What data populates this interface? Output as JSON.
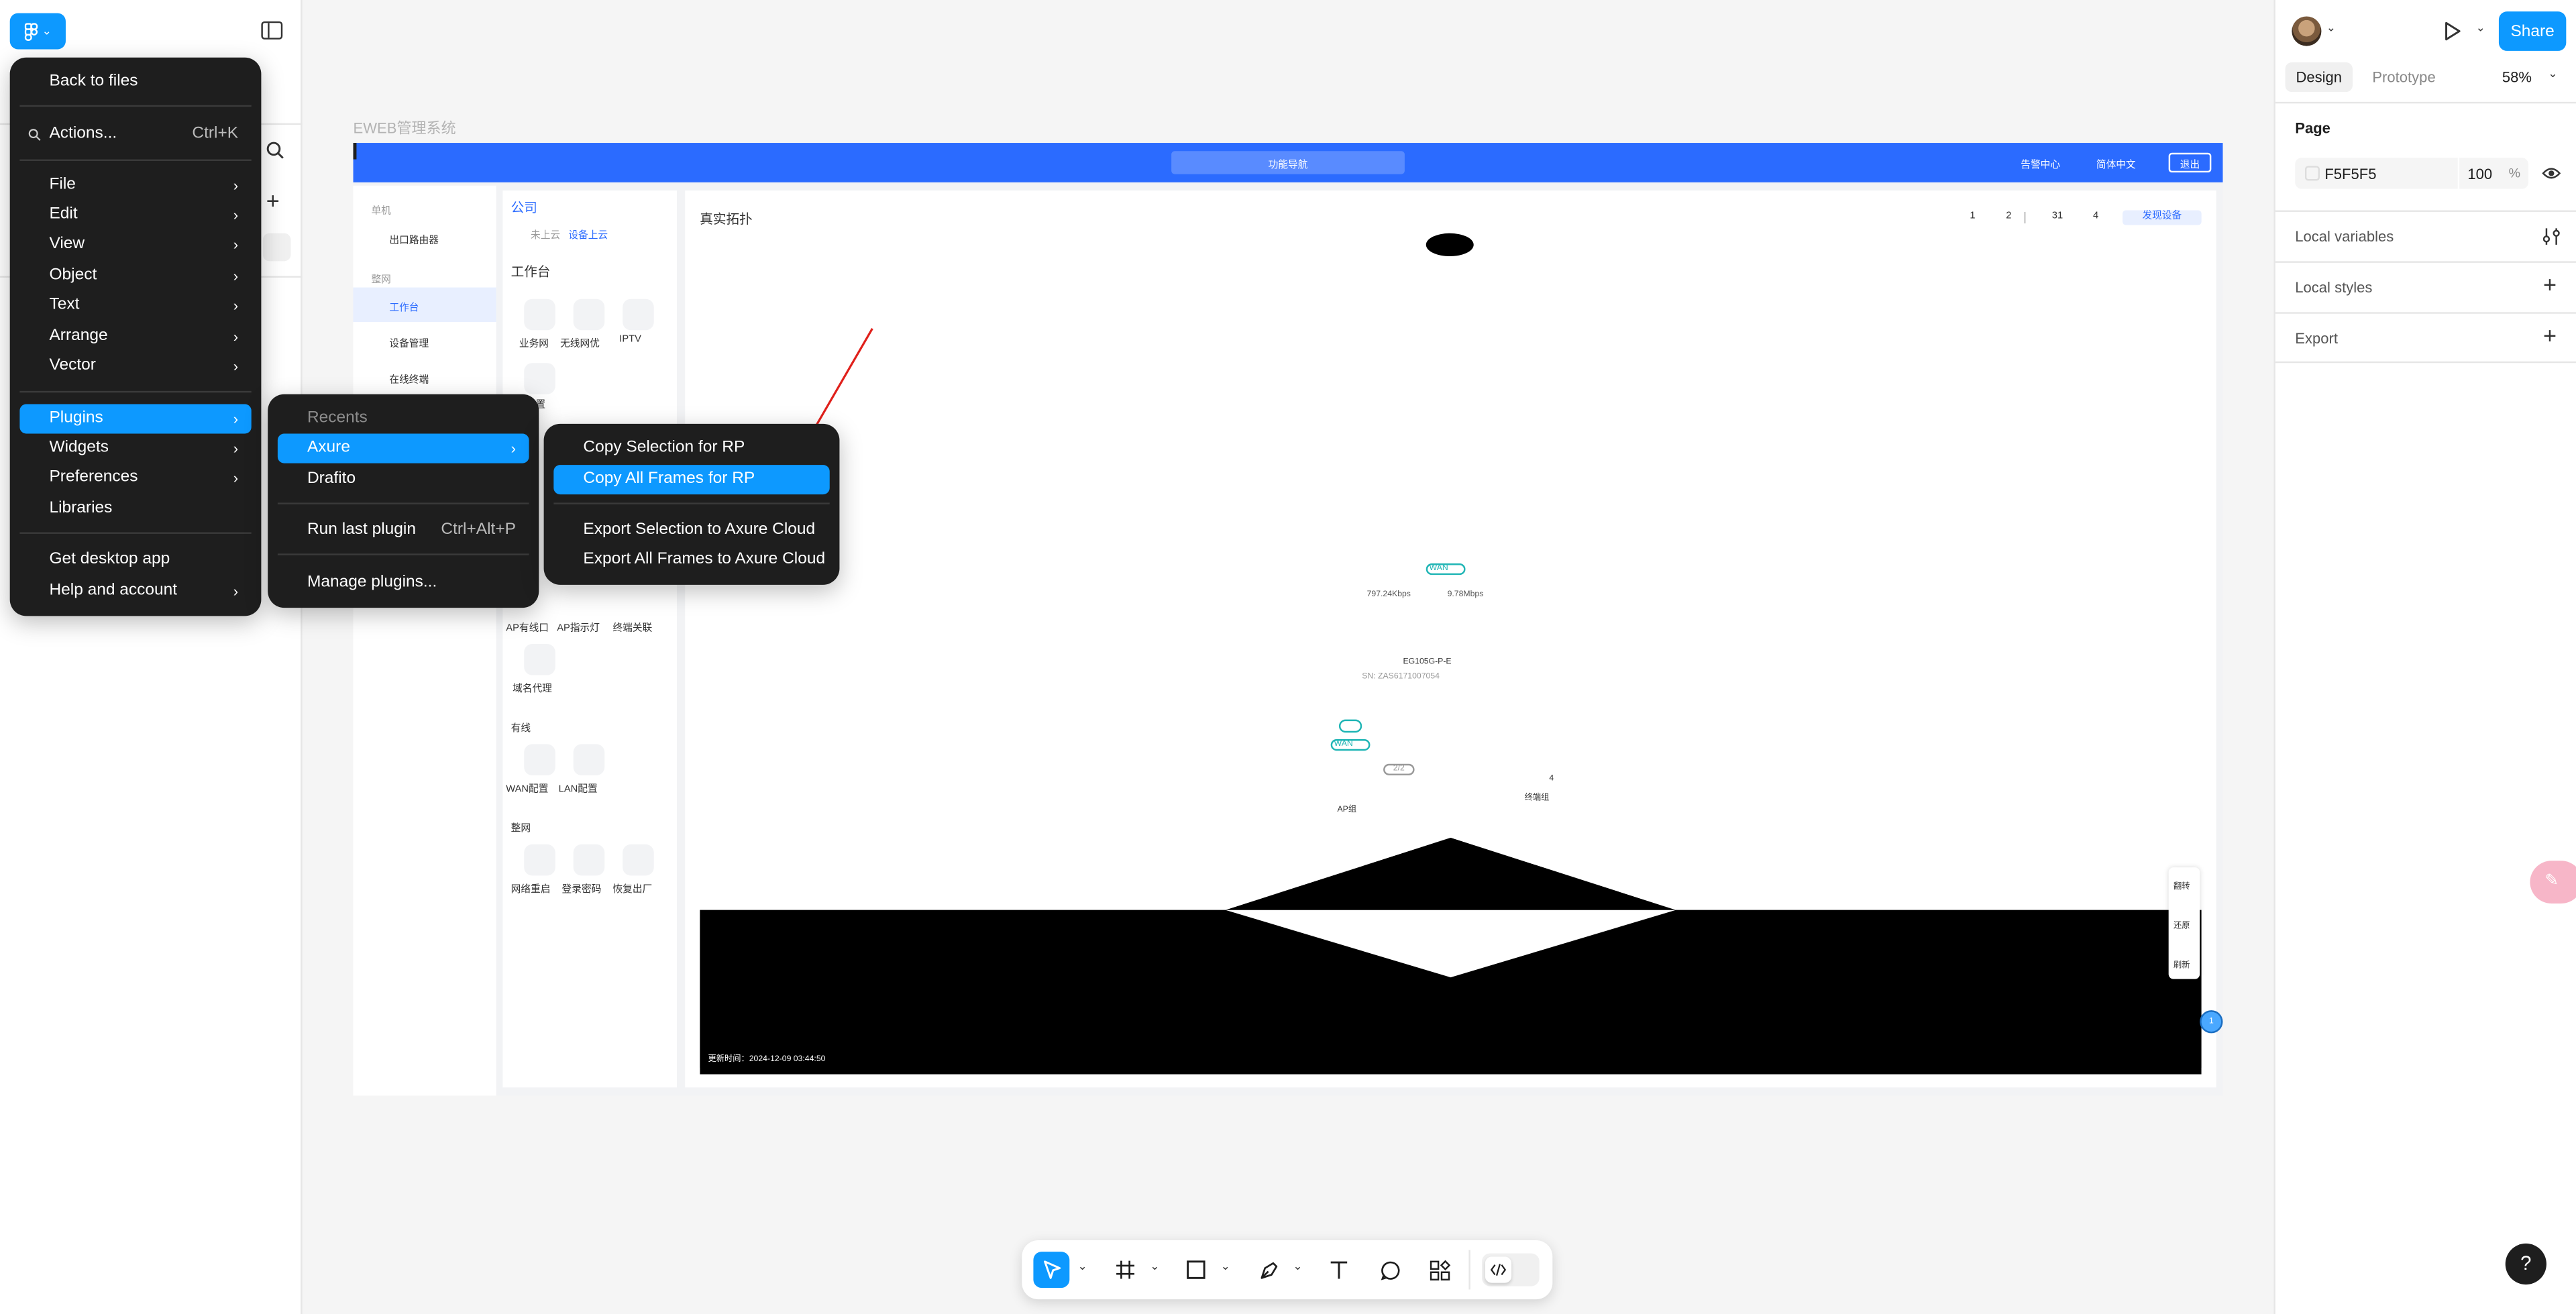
{
  "app": {
    "logo_caret": "⌄",
    "colors": {
      "accent": "#0d99ff",
      "frame_header": "#2b6bff",
      "menu_bg": "#1e1e1e"
    }
  },
  "main_menu": {
    "items": [
      {
        "label": "Back to files"
      },
      {
        "label": "Actions...",
        "shortcut": "Ctrl+K",
        "icon": "search-icon"
      },
      {
        "label": "File"
      },
      {
        "label": "Edit"
      },
      {
        "label": "View"
      },
      {
        "label": "Object"
      },
      {
        "label": "Text"
      },
      {
        "label": "Arrange"
      },
      {
        "label": "Vector"
      },
      {
        "label": "Plugins"
      },
      {
        "label": "Widgets"
      },
      {
        "label": "Preferences"
      },
      {
        "label": "Libraries"
      },
      {
        "label": "Get desktop app"
      },
      {
        "label": "Help and account"
      }
    ],
    "submenu_arrow": "›"
  },
  "plugins_menu": {
    "header": "Recents",
    "items": [
      {
        "label": "Axure"
      },
      {
        "label": "Drafito"
      },
      {
        "label": "Run last plugin",
        "shortcut": "Ctrl+Alt+P"
      },
      {
        "label": "Manage plugins..."
      }
    ]
  },
  "axure_menu": {
    "items": [
      {
        "label": "Copy Selection for RP"
      },
      {
        "label": "Copy All Frames for RP"
      },
      {
        "label": "Export Selection to Axure Cloud"
      },
      {
        "label": "Export All Frames to Axure Cloud"
      }
    ]
  },
  "canvas": {
    "frame_label": "EWEB管理系统",
    "frame": {
      "nav_center": "功能导航",
      "top_links": [
        "告警中心",
        "简体中文"
      ],
      "logout": "退出",
      "col1": {
        "section_single": "单机",
        "item_router": "出口路由器",
        "section_network": "整网",
        "items": [
          "工作台",
          "设备管理",
          "在线终端"
        ]
      },
      "col2": {
        "company": "公司",
        "cloud_off": "未上云",
        "cloud_on": "设备上云",
        "workbench": "工作台",
        "tiles_row1": [
          "业务网",
          "无线网优",
          "IPTV"
        ],
        "tile_cut": "置",
        "tiles_ap": [
          "AP有线口",
          "AP指示灯",
          "终端关联"
        ],
        "tile_domain": "域名代理",
        "section_wired": "有线",
        "tiles_wired": [
          "WAN配置",
          "LAN配置"
        ],
        "section_net": "整网",
        "tiles_net": [
          "网络重启",
          "登录密码",
          "恢复出厂"
        ]
      },
      "col3": {
        "title": "真实拓扑",
        "header_nums": [
          "1",
          "2",
          "31",
          "4"
        ],
        "discover_btn": "发现设备",
        "wan_badge": "WAN",
        "speed_down": "797.24Kbps",
        "speed_up": "9.78Mbps",
        "device_model": "EG105G-P-E",
        "device_sn": "SN: ZAS6171007054",
        "wan_badge2": "WAN",
        "pill_count": "2/2",
        "ap_group": "AP组",
        "term_count": "4",
        "term_group": "终端组",
        "side_buttons": [
          "翻转",
          "还原",
          "刷新"
        ],
        "timestamp": "更新时间：2024-12-09 03:44:50",
        "fab": "1"
      }
    }
  },
  "right_panel": {
    "tabs": [
      "Design",
      "Prototype"
    ],
    "zoom": "58%",
    "share": "Share",
    "page_section": "Page",
    "page_color": "F5F5F5",
    "page_opacity": "100",
    "percent": "%",
    "local_variables": "Local variables",
    "local_styles": "Local styles",
    "export": "Export"
  },
  "help": "?"
}
